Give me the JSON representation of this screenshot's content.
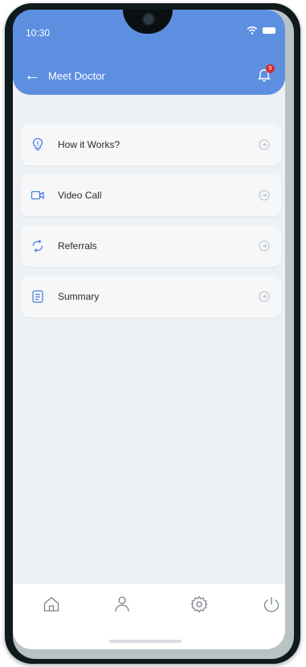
{
  "status_bar": {
    "time": "10:30"
  },
  "header": {
    "title": "Meet Doctor",
    "notification_count": "9"
  },
  "menu": {
    "items": [
      {
        "label": "How it Works?",
        "icon": "lightbulb-icon"
      },
      {
        "label": "Video Call",
        "icon": "video-icon"
      },
      {
        "label": "Referrals",
        "icon": "refresh-icon"
      },
      {
        "label": "Summary",
        "icon": "document-icon"
      }
    ]
  },
  "bottom_nav": {
    "tabs": [
      {
        "icon": "home-icon"
      },
      {
        "icon": "user-icon"
      },
      {
        "icon": "settings-icon"
      },
      {
        "icon": "power-icon"
      }
    ]
  },
  "colors": {
    "header_bg": "#5d8fe1",
    "accent": "#4b7fe0",
    "badge": "#d32f2f"
  }
}
